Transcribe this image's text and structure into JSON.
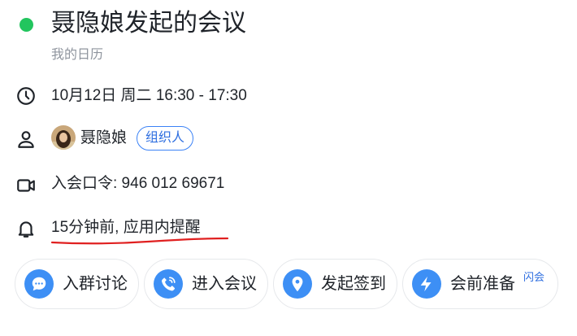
{
  "meeting": {
    "title": "聂隐娘发起的会议",
    "calendar": "我的日历",
    "status_color": "#22c55e"
  },
  "details": {
    "time": "10月12日 周二 16:30 - 17:30",
    "organizer_name": "聂隐娘",
    "organizer_badge": "组织人",
    "meeting_code": "入会口令:  946 012 69671",
    "reminder": "15分钟前, 应用内提醒"
  },
  "icons": {
    "time": "clock-icon",
    "organizer": "person-icon",
    "code": "video-camera-icon",
    "reminder": "bell-icon"
  },
  "actions": [
    {
      "label": "入群讨论",
      "icon": "chat-bubble-icon"
    },
    {
      "label": "进入会议",
      "icon": "phone-icon"
    },
    {
      "label": "发起签到",
      "icon": "location-pin-icon"
    },
    {
      "label": "会前准备",
      "icon": "lightning-icon",
      "tag": "闪会"
    }
  ],
  "colors": {
    "accent": "#3d8ff5",
    "badge": "#2f6fe0",
    "annotation": "#e02020"
  }
}
